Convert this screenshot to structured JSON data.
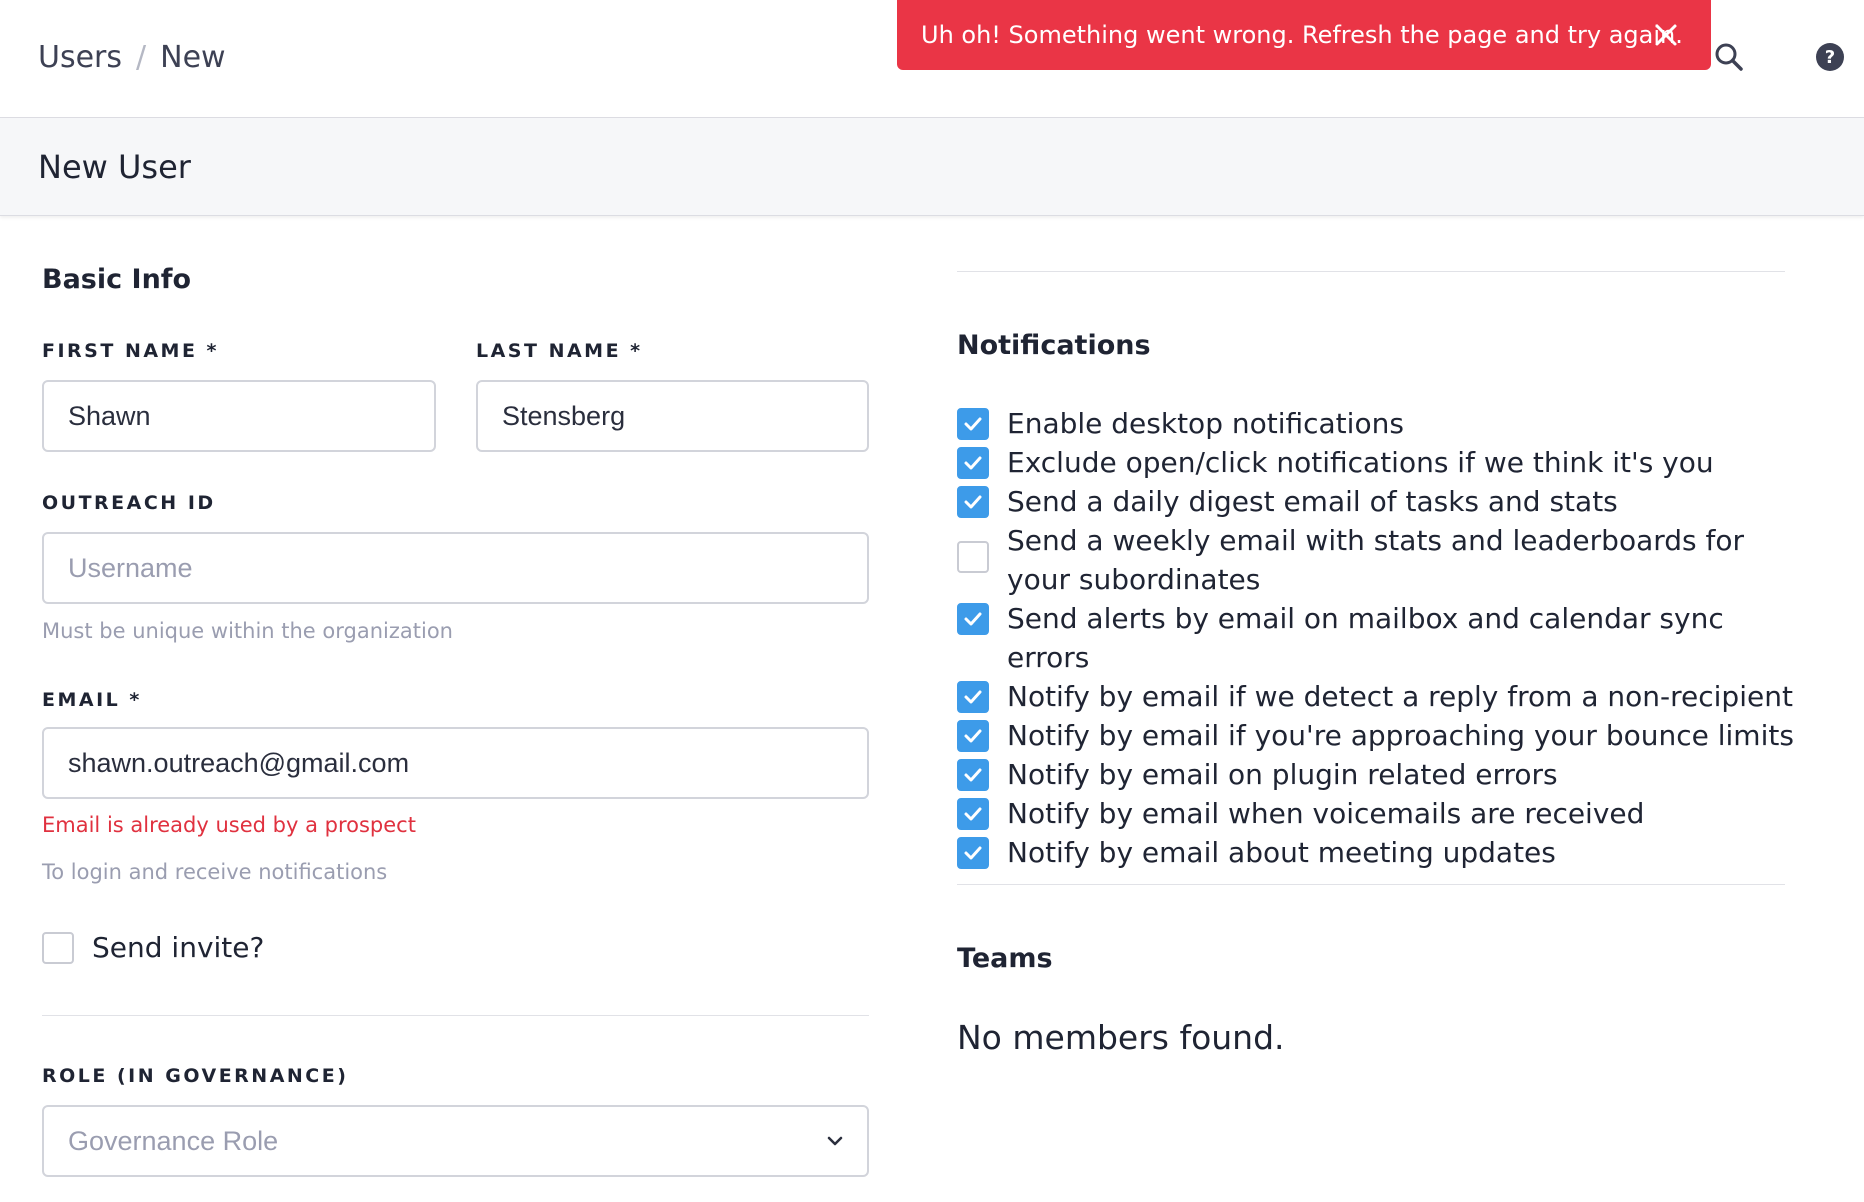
{
  "breadcrumb": {
    "parent": "Users",
    "separator": "/",
    "current": "New"
  },
  "toast": {
    "message": "Uh oh! Something went wrong. Refresh the page and try again.",
    "color": "#ea3546"
  },
  "page": {
    "title": "New User"
  },
  "basic_info": {
    "title": "Basic Info",
    "first_name": {
      "label": "FIRST NAME *",
      "value": "Shawn"
    },
    "last_name": {
      "label": "LAST NAME *",
      "value": "Stensberg"
    },
    "outreach_id": {
      "label": "OUTREACH ID",
      "placeholder": "Username",
      "help": "Must be unique within the organization"
    },
    "email": {
      "label": "EMAIL *",
      "value": "shawn.outreach@gmail.com",
      "error": "Email is already used by a prospect",
      "help": "To login and receive notifications"
    },
    "send_invite": {
      "label": "Send invite?",
      "checked": false
    },
    "role": {
      "label": "ROLE (IN GOVERNANCE)",
      "placeholder": "Governance Role"
    }
  },
  "notifications": {
    "title": "Notifications",
    "items": [
      {
        "label": "Enable desktop notifications",
        "checked": true
      },
      {
        "label": "Exclude open/click notifications if we think it's you",
        "checked": true
      },
      {
        "label": "Send a daily digest email of tasks and stats",
        "checked": true
      },
      {
        "label": "Send a weekly email with stats and leaderboards for your subordinates",
        "checked": false
      },
      {
        "label": "Send alerts by email on mailbox and calendar sync errors",
        "checked": true
      },
      {
        "label": "Notify by email if we detect a reply from a non-recipient",
        "checked": true
      },
      {
        "label": "Notify by email if you're approaching your bounce limits",
        "checked": true
      },
      {
        "label": "Notify by email on plugin related errors",
        "checked": true
      },
      {
        "label": "Notify by email when voicemails are received",
        "checked": true
      },
      {
        "label": "Notify by email about meeting updates",
        "checked": true
      }
    ]
  },
  "teams": {
    "title": "Teams",
    "empty": "No members found."
  },
  "colors": {
    "accent": "#3d9be9",
    "error": "#e0313f",
    "text": "#1f2433"
  },
  "icons": {
    "search": "search-icon",
    "help": "help-icon",
    "close": "close-icon",
    "chevron": "chevron-down-icon",
    "check": "check-icon"
  }
}
